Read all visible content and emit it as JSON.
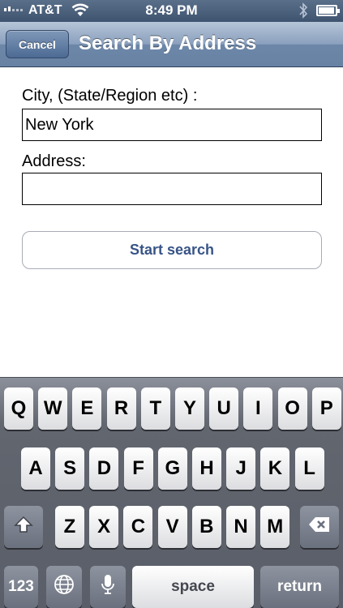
{
  "status_bar": {
    "carrier": "AT&T",
    "time": "8:49 PM",
    "icons": [
      "signal-icon",
      "wifi-icon",
      "bluetooth-icon",
      "battery-icon"
    ],
    "battery_level": 0.85
  },
  "nav": {
    "cancel_label": "Cancel",
    "title": "Search By Address"
  },
  "form": {
    "city_label": "City, (State/Region etc) :",
    "city_value": "New York",
    "address_label": "Address:",
    "address_value": "",
    "search_button_label": "Start search"
  },
  "keyboard": {
    "row1": [
      "Q",
      "W",
      "E",
      "R",
      "T",
      "Y",
      "U",
      "I",
      "O",
      "P"
    ],
    "row2": [
      "A",
      "S",
      "D",
      "F",
      "G",
      "H",
      "J",
      "K",
      "L"
    ],
    "row3": [
      "Z",
      "X",
      "C",
      "V",
      "B",
      "N",
      "M"
    ],
    "numbers_label": "123",
    "space_label": "space",
    "return_label": "return",
    "icons": [
      "shift-icon",
      "delete-icon",
      "globe-icon",
      "microphone-icon"
    ]
  },
  "colors": {
    "nav_bar": "#6d87a9",
    "search_button_text": "#385487",
    "keyboard_bg": "#5a5e68"
  }
}
